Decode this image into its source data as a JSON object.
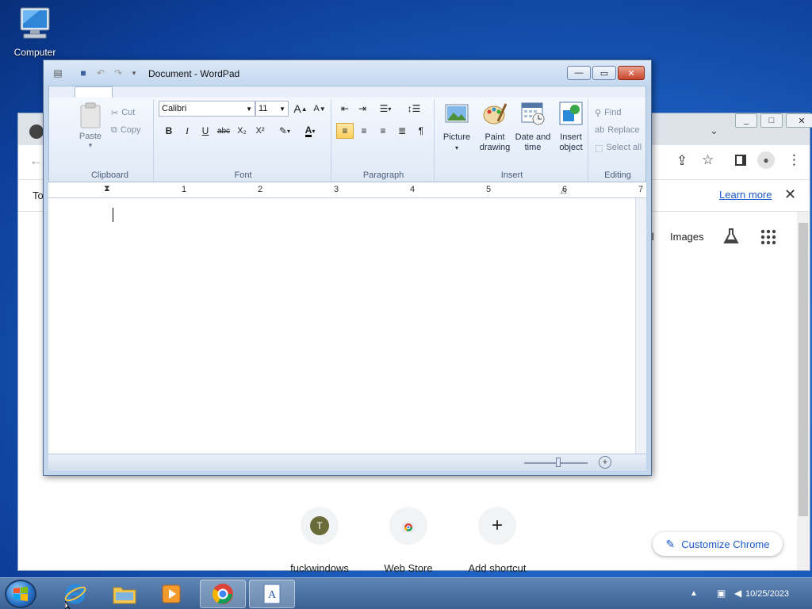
{
  "desktop": {
    "icons": [
      {
        "label": "Computer",
        "icon": "computer-icon"
      }
    ]
  },
  "chrome": {
    "infobar_prefix": "To",
    "learn_more": "Learn more",
    "header_links": {
      "partial": "il",
      "images": "Images"
    },
    "shortcuts": [
      {
        "label": "fuckwindows",
        "initial": "T"
      },
      {
        "label": "Web Store"
      },
      {
        "label": "Add shortcut",
        "symbol": "+"
      }
    ],
    "customize_label": "Customize Chrome",
    "window_buttons": [
      "_",
      "□",
      "✕"
    ]
  },
  "wordpad": {
    "title": "Document - WordPad",
    "window_buttons": {
      "minimize": "—",
      "maximize": "▭",
      "close": "✕"
    },
    "ribbon": {
      "clipboard": {
        "label": "Clipboard",
        "paste": "Paste",
        "cut": "Cut",
        "copy": "Copy"
      },
      "font": {
        "label": "Font",
        "family": "Calibri",
        "size": "11",
        "grow": "A",
        "shrink": "A",
        "bold": "B",
        "italic": "I",
        "underline": "U",
        "strike": "abc",
        "subscript": "X₂",
        "superscript": "X²"
      },
      "paragraph": {
        "label": "Paragraph"
      },
      "insert": {
        "label": "Insert",
        "picture": "Picture",
        "paint_line1": "Paint",
        "paint_line2": "drawing",
        "date_line1": "Date and",
        "date_line2": "time",
        "object_line1": "Insert",
        "object_line2": "object"
      },
      "editing": {
        "label": "Editing",
        "find": "Find",
        "replace": "Replace",
        "select_all": "Select all"
      }
    },
    "ruler_numbers": [
      "1",
      "2",
      "3",
      "4",
      "5",
      "6",
      "7"
    ]
  },
  "taskbar": {
    "clock": "10/25/2023"
  },
  "colors": {
    "accent": "#1a57c9",
    "title_bar": "#c3d7ef",
    "taskbar": "#3b6193"
  }
}
